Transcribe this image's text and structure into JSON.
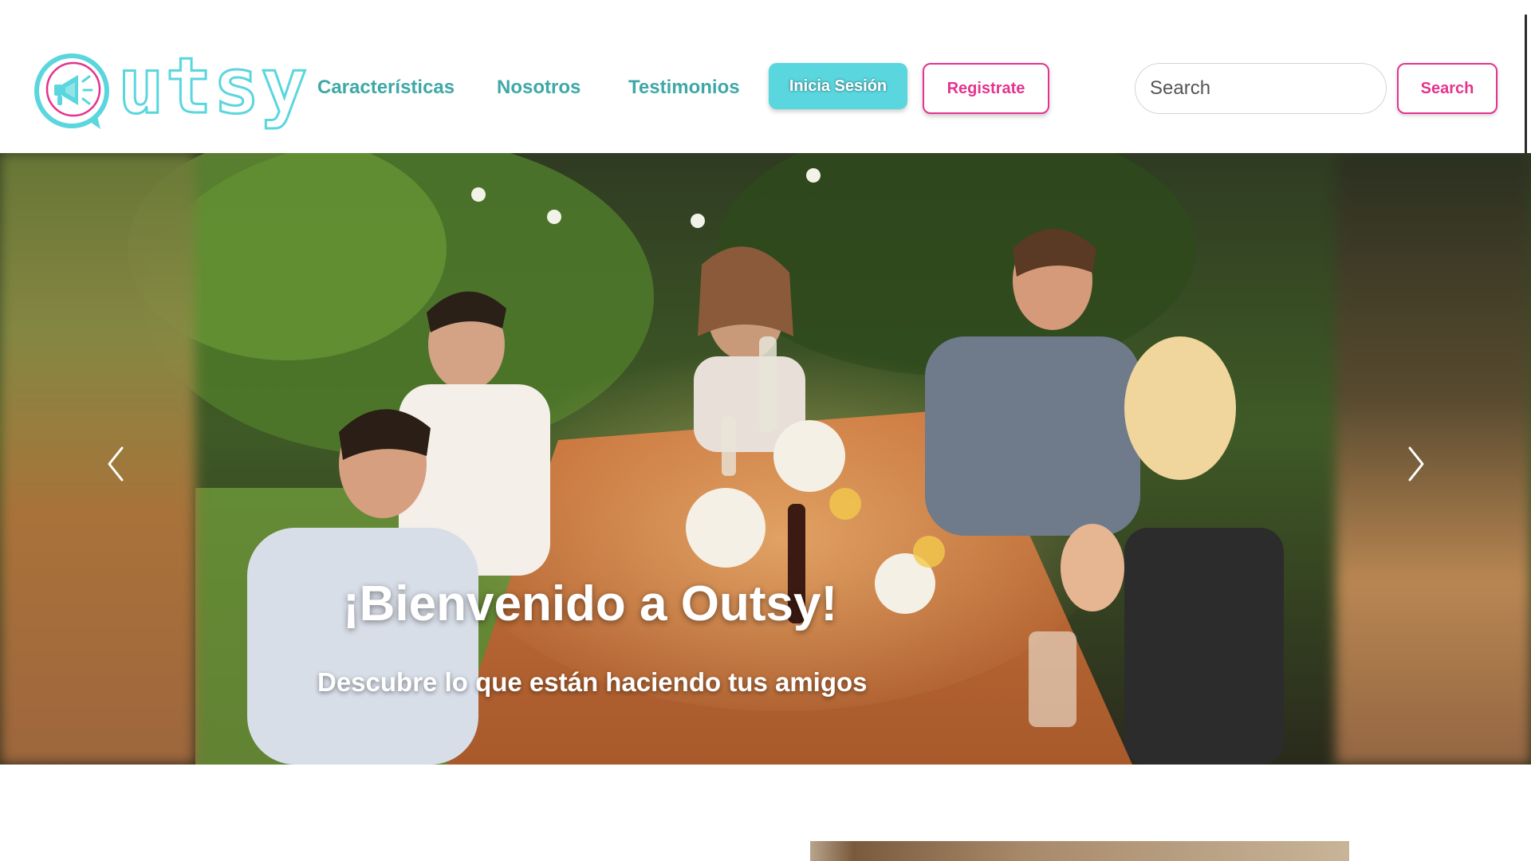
{
  "brand": {
    "logo_text": "utsy",
    "logo_color": "#5ad6de",
    "logo_accent_color": "#e4338e",
    "icon": "megaphone-icon"
  },
  "nav": {
    "links": [
      {
        "label": "Características"
      },
      {
        "label": "Nosotros"
      },
      {
        "label": "Testimonios"
      }
    ],
    "login_label": "Inicia Sesión",
    "register_label": "Registrate"
  },
  "search": {
    "placeholder": "Search",
    "button_label": "Search"
  },
  "carousel": {
    "title": "¡Bienvenido a Outsy!",
    "subtitle": "Descubre lo que están haciendo tus amigos",
    "prev_icon": "chevron-left-icon",
    "next_icon": "chevron-right-icon"
  },
  "colors": {
    "nav_text": "#3fa8a7",
    "primary": "#5ad6de",
    "accent": "#e4338e"
  }
}
